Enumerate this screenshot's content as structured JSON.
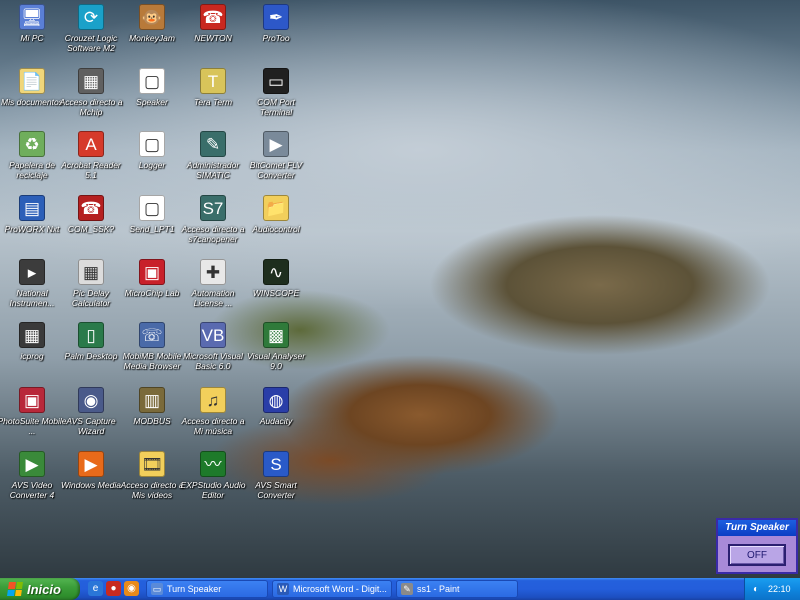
{
  "desktop": {
    "icons": [
      {
        "label": "Mi PC",
        "icon": "computer-icon",
        "glyph": "🖥",
        "color": "#5a7fd6"
      },
      {
        "label": "Crouzet Logic Software M2",
        "icon": "crouzet-icon",
        "glyph": "⟳",
        "color": "#1aa1c9"
      },
      {
        "label": "MonkeyJam",
        "icon": "monkey-icon",
        "glyph": "🐵",
        "color": "#b87a3a"
      },
      {
        "label": "NEWTON",
        "icon": "newton-icon",
        "glyph": "☎",
        "color": "#c9281f"
      },
      {
        "label": "ProToo",
        "icon": "protoo-icon",
        "glyph": "✒",
        "color": "#2d58c8"
      },
      {
        "label": "Mis documentos",
        "icon": "folder-documents-icon",
        "glyph": "📄",
        "color": "#f0d67a"
      },
      {
        "label": "Acceso directo a Mchip",
        "icon": "chip-icon",
        "glyph": "▦",
        "color": "#606060"
      },
      {
        "label": "Speaker",
        "icon": "file-icon",
        "glyph": "▢",
        "color": "#ffffff"
      },
      {
        "label": "Tera Term",
        "icon": "teraterm-icon",
        "glyph": "T",
        "color": "#d8c45a"
      },
      {
        "label": "COM Port Terminal",
        "icon": "terminal-icon",
        "glyph": "▭",
        "color": "#202020"
      },
      {
        "label": "Papelera de reciclaje",
        "icon": "recycle-bin-icon",
        "glyph": "♻",
        "color": "#6fae5c"
      },
      {
        "label": "Acrobat Reader 5.1",
        "icon": "acrobat-icon",
        "glyph": "A",
        "color": "#d63a2a"
      },
      {
        "label": "Logger",
        "icon": "file-icon",
        "glyph": "▢",
        "color": "#ffffff"
      },
      {
        "label": "Administrador SIMATIC",
        "icon": "simatic-icon",
        "glyph": "✎",
        "color": "#3a6e6a"
      },
      {
        "label": "BitComet FLV Converter",
        "icon": "bitcomet-icon",
        "glyph": "▶",
        "color": "#7a8a9a"
      },
      {
        "label": "ProWORX Nxt",
        "icon": "proworx-icon",
        "glyph": "▤",
        "color": "#2c5fb8"
      },
      {
        "label": "COM_SSK?",
        "icon": "telephone-icon",
        "glyph": "☎",
        "color": "#b52020"
      },
      {
        "label": "Send_LPT1",
        "icon": "file-icon",
        "glyph": "▢",
        "color": "#ffffff"
      },
      {
        "label": "Acceso directo a s7canopener",
        "icon": "s7-icon",
        "glyph": "S7",
        "color": "#3a6e6a"
      },
      {
        "label": "Audiocontrol",
        "icon": "folder-icon",
        "glyph": "📁",
        "color": "#f2cf5b"
      },
      {
        "label": "National Instrumen...",
        "icon": "national-instruments-icon",
        "glyph": "▸",
        "color": "#3c3c3c"
      },
      {
        "label": "Pic Delay Calculator",
        "icon": "calculator-icon",
        "glyph": "▦",
        "color": "#dcdcdc"
      },
      {
        "label": "MicroChip Lab",
        "icon": "microchip-icon",
        "glyph": "▣",
        "color": "#c8202a"
      },
      {
        "label": "Automation License ...",
        "icon": "license-icon",
        "glyph": "✚",
        "color": "#e8e8e8"
      },
      {
        "label": "WINSCOPE",
        "icon": "oscilloscope-icon",
        "glyph": "∿",
        "color": "#1e2e1e"
      },
      {
        "label": "icprog",
        "icon": "icprog-icon",
        "glyph": "▦",
        "color": "#3a3a3a"
      },
      {
        "label": "Palm Desktop",
        "icon": "palm-icon",
        "glyph": "▯",
        "color": "#2a7a4a"
      },
      {
        "label": "MobiMB Mobile Media Browser",
        "icon": "mobile-icon",
        "glyph": "☏",
        "color": "#4a6aa8"
      },
      {
        "label": "Microsoft Visual Basic 6.0",
        "icon": "visual-basic-icon",
        "glyph": "VB",
        "color": "#5a6ab0"
      },
      {
        "label": "Visual Analyser 9.0",
        "icon": "analyser-icon",
        "glyph": "▩",
        "color": "#2f7a3a"
      },
      {
        "label": "PhotoSuite Mobile ...",
        "icon": "photosuite-icon",
        "glyph": "▣",
        "color": "#b8283a"
      },
      {
        "label": "AVS Capture Wizard",
        "icon": "avs-capture-icon",
        "glyph": "◉",
        "color": "#4a5a8a"
      },
      {
        "label": "MODBUS",
        "icon": "modbus-icon",
        "glyph": "▥",
        "color": "#7a6a3a"
      },
      {
        "label": "Acceso directo a Mi música",
        "icon": "music-folder-icon",
        "glyph": "♫",
        "color": "#f2cf5b"
      },
      {
        "label": "Audacity",
        "icon": "audacity-icon",
        "glyph": "◍",
        "color": "#2a3ea8"
      },
      {
        "label": "AVS Video Converter 4",
        "icon": "avs-video-icon",
        "glyph": "▶",
        "color": "#3a8a3a"
      },
      {
        "label": "Windows Media",
        "icon": "windows-media-icon",
        "glyph": "▶",
        "color": "#e86a1a"
      },
      {
        "label": "Acceso directo a Mis videos",
        "icon": "video-folder-icon",
        "glyph": "🎞",
        "color": "#f2cf5b"
      },
      {
        "label": "EXPStudio Audio Editor",
        "icon": "audio-editor-icon",
        "glyph": "〰",
        "color": "#1e7a2a"
      },
      {
        "label": "AVS Smart Converter",
        "icon": "avs-smart-icon",
        "glyph": "S",
        "color": "#2a5ac8"
      }
    ]
  },
  "widget": {
    "title": "Turn Speaker",
    "button": "OFF"
  },
  "taskbar": {
    "start_label": "Inicio",
    "quick_launch": [
      {
        "icon": "ie-icon",
        "glyph": "e",
        "color": "#2a76d8"
      },
      {
        "icon": "media-icon",
        "glyph": "●",
        "color": "#c82a20"
      },
      {
        "icon": "firefox-icon",
        "glyph": "◉",
        "color": "#e88a1a"
      }
    ],
    "tasks": [
      {
        "label": "Turn Speaker",
        "icon": "window-icon",
        "glyph": "▭",
        "color": "#5a8ad8"
      },
      {
        "label": "Microsoft Word - Digit...",
        "icon": "word-icon",
        "glyph": "W",
        "color": "#2a5ab8"
      },
      {
        "label": "ss1 - Paint",
        "icon": "paint-icon",
        "glyph": "✎",
        "color": "#8a8a8a"
      }
    ],
    "tray_icon": {
      "icon": "volume-icon",
      "glyph": "◐"
    },
    "clock": "22:10"
  }
}
